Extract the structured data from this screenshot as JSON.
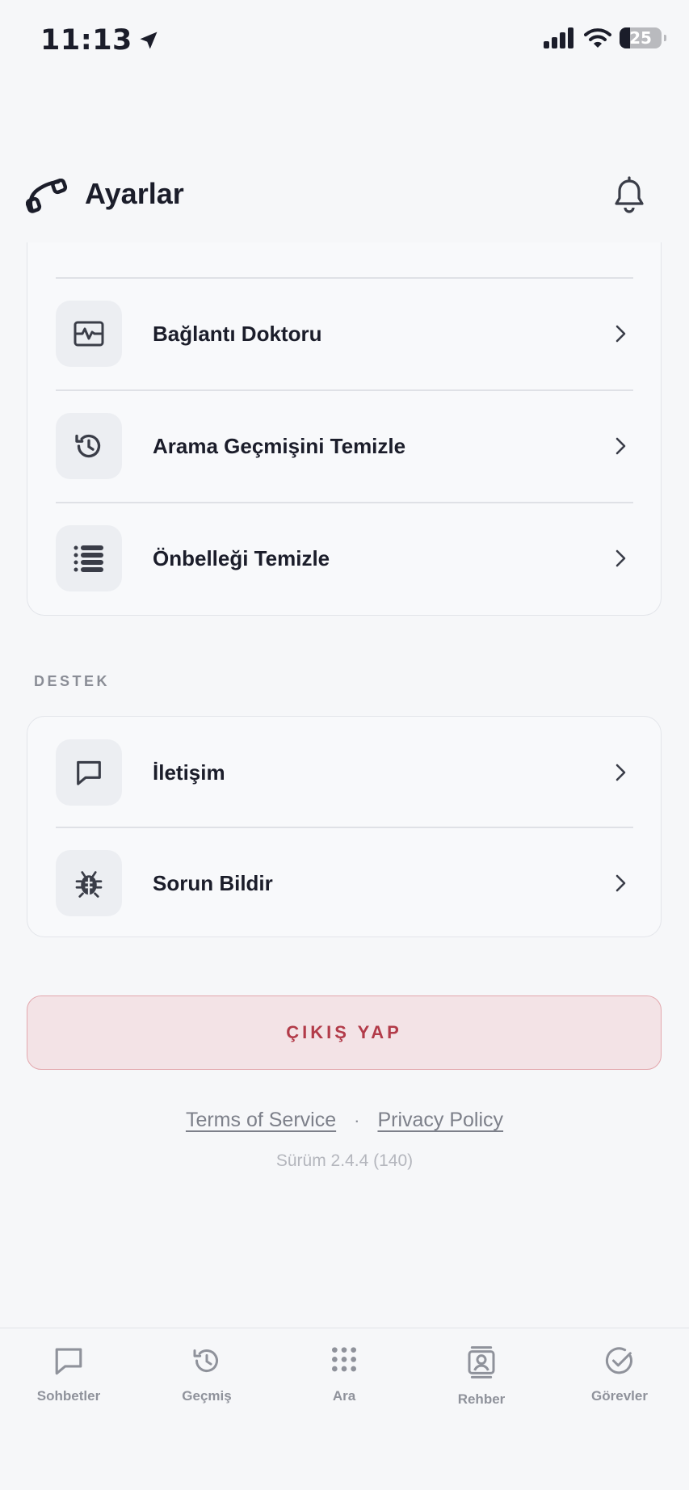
{
  "status_bar": {
    "time": "11:13",
    "battery": "25"
  },
  "header": {
    "title": "Ayarlar"
  },
  "tools": [
    {
      "label": "Bağlantı Doktoru",
      "icon": "activity-monitor-icon"
    },
    {
      "label": "Arama Geçmişini Temizle",
      "icon": "history-icon"
    },
    {
      "label": "Önbelleği Temizle",
      "icon": "list-icon"
    }
  ],
  "support": {
    "section_title": "DESTEK",
    "items": [
      {
        "label": "İletişim",
        "icon": "message-icon"
      },
      {
        "label": "Sorun Bildir",
        "icon": "bug-icon"
      }
    ]
  },
  "logout_label": "ÇIKIŞ YAP",
  "footer": {
    "terms": "Terms of Service",
    "separator": "·",
    "privacy": "Privacy Policy",
    "version": "Sürüm 2.4.4 (140)"
  },
  "tabs": [
    {
      "label": "Sohbetler",
      "icon": "chat-icon"
    },
    {
      "label": "Geçmiş",
      "icon": "history-icon"
    },
    {
      "label": "Ara",
      "icon": "dialpad-icon"
    },
    {
      "label": "Rehber",
      "icon": "contacts-icon"
    },
    {
      "label": "Görevler",
      "icon": "check-circle-icon"
    }
  ],
  "colors": {
    "accent_danger": "#b23b49",
    "text_primary": "#1b1d2a",
    "muted": "#8f929b"
  }
}
